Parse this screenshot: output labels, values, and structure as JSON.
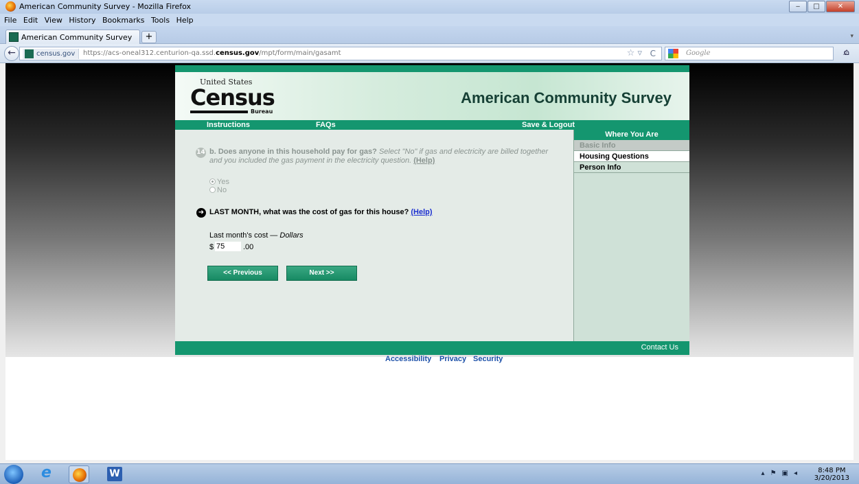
{
  "window": {
    "title": "American Community Survey - Mozilla Firefox",
    "buttons": {
      "minimize": "‒",
      "maximize": "□",
      "close": "✕"
    }
  },
  "menu": [
    "File",
    "Edit",
    "View",
    "History",
    "Bookmarks",
    "Tools",
    "Help"
  ],
  "tabs": [
    {
      "label": "American Community Survey"
    }
  ],
  "new_tab": "+",
  "address": {
    "site_identity": "census.gov",
    "url_prefix": "https://acs-oneal312.centurion-qa.ssd.",
    "url_domain": "census.gov",
    "url_suffix": "/mpt/form/main/gasamt"
  },
  "search": {
    "placeholder": "Google"
  },
  "header": {
    "logo_top": "United States",
    "logo_main": "Census",
    "logo_bottom": "Bureau",
    "title": "American Community Survey"
  },
  "nav": {
    "instructions": "Instructions",
    "faqs": "FAQs",
    "save_logout": "Save & Logout"
  },
  "sidebar": {
    "title": "Where You Are",
    "items": [
      {
        "label": "Basic Info",
        "state": "disabled"
      },
      {
        "label": "Housing Questions",
        "state": "current"
      },
      {
        "label": "Person Info",
        "state": "normal"
      }
    ]
  },
  "question_b": {
    "number": "14",
    "bold": "b. Does anyone in this household pay for gas?",
    "italic": "Select \"No\" if gas and electricity are billed together and you included the gas payment in the electricity question.",
    "help": "(Help)",
    "options": [
      {
        "label": "Yes",
        "selected": true
      },
      {
        "label": "No",
        "selected": false
      }
    ]
  },
  "question_cost": {
    "text": "LAST MONTH, what was the cost of gas for this house?",
    "help": "(Help)",
    "label_plain": "Last month's cost — ",
    "label_italic": "Dollars",
    "currency": "$",
    "value": "75",
    "cents": ".00"
  },
  "buttons": {
    "previous": "<<   Previous",
    "next": "Next   >>"
  },
  "footer": {
    "contact": "Contact Us"
  },
  "bottom_links": {
    "accessibility": "Accessibility",
    "privacy": "Privacy",
    "security": "Security"
  },
  "taskbar": {
    "time": "8:48 PM",
    "date": "3/20/2013"
  },
  "colors": {
    "census_green": "#14966f",
    "sidebar_bg": "#cfe1d7",
    "content_bg": "#e4ebe7",
    "link_blue": "#1b2fd0"
  }
}
